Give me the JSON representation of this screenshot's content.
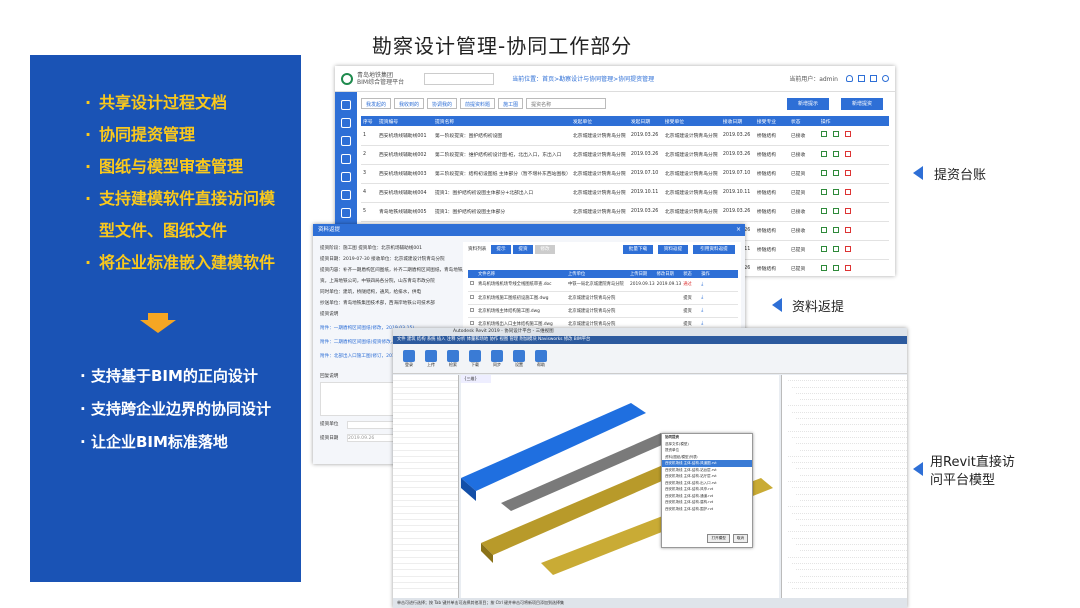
{
  "title": "勘察设计管理-协同工作部分",
  "features": [
    "共享设计过程文档",
    "协同提资管理",
    "图纸与模型审查管理",
    "支持建模软件直接访问模",
    "型文件、图纸文件",
    "将企业标准嵌入建模软件"
  ],
  "outcomes": [
    "支持基于BIM的正向设计",
    "支持跨企业边界的协同设计",
    "让企业BIM标准落地"
  ],
  "annotations": {
    "ledger": "提资台账",
    "feedback": "资料返提",
    "revit_line1": "用Revit直接访",
    "revit_line2": "问平台模型"
  },
  "colors": {
    "panel_blue": "#1a53b5",
    "accent_yellow": "#fbc91b",
    "arrow_orange": "#f5a623",
    "ui_blue": "#2e6fd6"
  },
  "shot1": {
    "org_line1": "青岛地铁集团",
    "org_line2": "BIM综合管理平台",
    "breadcrumb": "当前位置：首页>勘察设计与协同管理>协同提资管理",
    "user": "当前用户：admin",
    "tabs": [
      "我发起的",
      "我收到的",
      "协调我的",
      "前提资料题",
      "施工图"
    ],
    "search_placeholder": "提资名称",
    "buttons": [
      "新增提示",
      "新增提资"
    ],
    "columns": [
      "序号",
      "提资编号",
      "提资名称",
      "发起单位",
      "发起日期",
      "接受单位",
      "接收日期",
      "接受专业",
      "状态",
      "操作"
    ],
    "rows": [
      [
        "1",
        "西安机场线辅助线001",
        "第一阶段提资：围护结构初设图",
        "北京城建设计院青岛分院",
        "2019.03.26",
        "北京城建设计院青岛分院",
        "2019.03.26",
        "桥隧结构",
        "已接收"
      ],
      [
        "2",
        "西安机场线辅助线002",
        "第二阶段提资：维护结构初设计图-桩，北出入口，东出入口",
        "北京城建设计院青岛分院",
        "2019.03.26",
        "北京城建设计院青岛分院",
        "2019.03.26",
        "桥隧结构",
        "已接收"
      ],
      [
        "3",
        "西安机场线辅助线003",
        "第三阶段提资：结构初设图纸 主体部分（暂不增补东西站围板）",
        "北京城建设计院青岛分院",
        "2019.07.10",
        "北京城建设计院青岛分院",
        "2019.07.10",
        "桥隧结构",
        "已提资"
      ],
      [
        "4",
        "西安机场线辅助线004",
        "提资1：围护结构初设图主体部分+北部出入口",
        "北京城建设计院青岛分院",
        "2019.10.11",
        "北京城建设计院青岛分院",
        "2019.10.11",
        "桥隧结构",
        "已提资"
      ],
      [
        "5",
        "青岛地铁线辅助线005",
        "提资1：围护结构初设图主体部分",
        "北京城建设计院青岛分院",
        "2019.03.26",
        "北京城建设计院青岛分院",
        "2019.03.26",
        "桥隧结构",
        "已接收"
      ],
      [
        "6",
        "青岛地铁线辅助线006",
        "提资1：围护结构初设图 出入口",
        "北京城建设计院青岛分院",
        "2019.03.26",
        "北京城建设计院青岛分院",
        "2019.03.26",
        "桥隧结构",
        "已接收"
      ],
      [
        "7",
        "",
        "",
        "",
        "",
        "",
        "2019.10.11",
        "桥隧结构",
        "已提资"
      ],
      [
        "8",
        "",
        "",
        "",
        "",
        "",
        "2019.03.26",
        "桥隧结构",
        "已提资"
      ]
    ]
  },
  "shot2": {
    "header": "资料返提",
    "info_lines": [
      "提资阶段：施工图      提资单位：北京机场辅助线001",
      "提资日期：2019-07-30   接收单位：北京城建设计院青岛分院",
      "提资内容：补齐一期盾构区间图纸，补齐二期盾构区间图纸，青岛地铁盾构",
      "资。上海地铁公司，中铁四局各分院，山东青岛市政分院",
      "同时单位：建筑，桥隧结构，通风，给排水，供电",
      "抄送单位：青岛地铁集团技术部，西海岸地铁公司技术部",
      "提资说明"
    ],
    "links": [
      "附件：一期盾构区间图纸(修改，2019.03.15)",
      "附件：二期盾构区间图纸(提资修改，2019.07.26)",
      "附件：北部出入口施工图(修订，2019.09.10)"
    ],
    "tabs": [
      "资料列表",
      "提示",
      "提资",
      "修改"
    ],
    "buttons": [
      "批量下载",
      "资料返提",
      "引用资料返提"
    ],
    "columns": [
      "文件名称",
      "上传单位",
      "上传日期",
      "修改日期",
      "状态",
      "操作"
    ],
    "files": [
      [
        "青岛机场线机场专线全线图纸审查.doc",
        "中铁一局北京城建院青岛分院",
        "2019.09.13",
        "2019.09.13",
        "通过"
      ],
      [
        "北京机场线施工图纸初设施工图.dwg",
        "北京城建设计院青岛分院",
        "",
        "",
        "提资"
      ],
      [
        "北京机场线主体结构施工图.dwg",
        "北京城建设计院青岛分院",
        "",
        "",
        "提资"
      ],
      [
        "北京机场线出入口主体结构施工图.dwg",
        "北京城建设计院青岛分院",
        "",
        "",
        "提资"
      ]
    ],
    "reply_label": "回复说明",
    "unit_label": "提资单位",
    "date_label": "提资日期",
    "date_value": "2019.09.26"
  },
  "shot3": {
    "title": "Autodesk Revit 2019 - 协同设计平台 - 三维视图",
    "menu": "文件  建筑  结构  系统  插入  注释  分析  体量和场地  协作  视图  管理  附加模块  Navisworks  修改  BIM平台",
    "ribbon": [
      "登录",
      "上传",
      "检索",
      "下载",
      "同步",
      "设置",
      "帮助"
    ],
    "view_tab": "{三维}",
    "dialog_title": "协同提资",
    "dialog_rows": [
      "选择文件(模型)",
      "提资单位",
      "资料(图纸/模型)列表：",
      "西安机场线 主体-结构-风道图.rvt",
      "西安机场线 主体-结构-站台层.rvt",
      "西安机场线 主体-结构-站厅层.rvt",
      "西安机场线 主体-结构-出入口.rvt",
      "西安机场线 主体-结构-风亭.rvt",
      "西安机场线 主体-结构-通道.rvt",
      "西安机场线 主体-结构-盾构.rvt",
      "西安机场线 主体-结构-围护.rvt"
    ],
    "dialog_buttons": [
      "打开模型",
      "取消"
    ],
    "status": "单击可进行选择；按 Tab 键并单击可选择其他项目；按 Ctrl 键并单击可将新项目添加到选择集"
  }
}
